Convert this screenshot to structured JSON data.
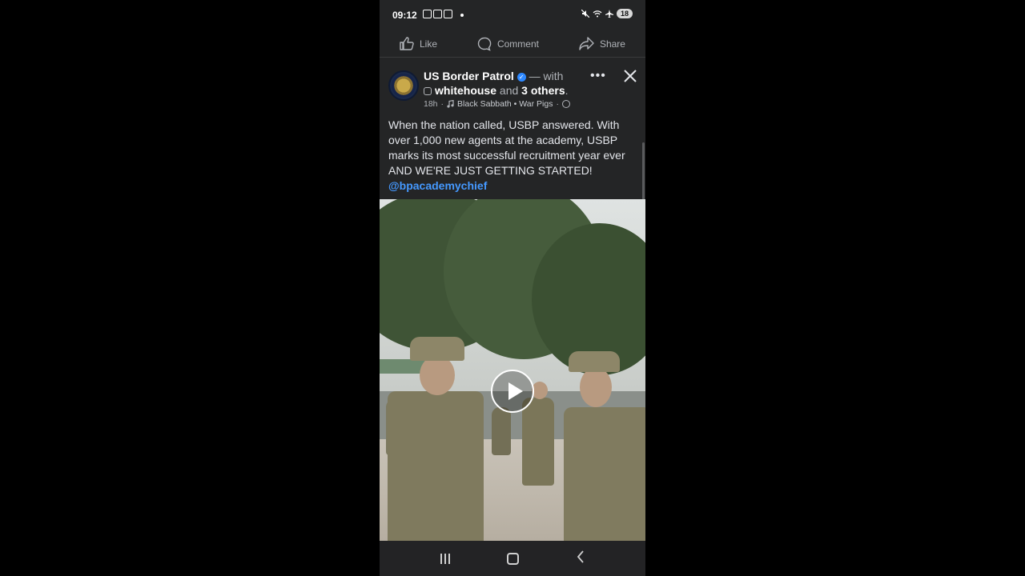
{
  "status_bar": {
    "time": "09:12",
    "battery": "18"
  },
  "actions": {
    "like": "Like",
    "comment": "Comment",
    "share": "Share"
  },
  "post": {
    "author": "US Border Patrol",
    "with_text": "— with",
    "tagged_1": "whitehouse",
    "and_text": "and",
    "tagged_others": "3 others",
    "period": ".",
    "time_ago": "18h",
    "song": "Black Sabbath • War Pigs",
    "body": "When the nation called, USBP answered. With over 1,000 new agents at the academy, USBP marks its most successful recruitment year ever AND WE'RE JUST GETTING STARTED!",
    "mention": "@bpacademychief"
  },
  "icons": {
    "like": "thumbs-up-icon",
    "comment": "speech-bubble-icon",
    "share": "share-arrow-icon",
    "more": "more-dots-icon",
    "close": "close-icon",
    "verified": "verified-badge-icon",
    "music": "music-note-icon",
    "privacy": "globe-icon",
    "play": "play-icon"
  },
  "colors": {
    "background": "#242526",
    "link": "#4599ff",
    "verified": "#2d88ff"
  }
}
